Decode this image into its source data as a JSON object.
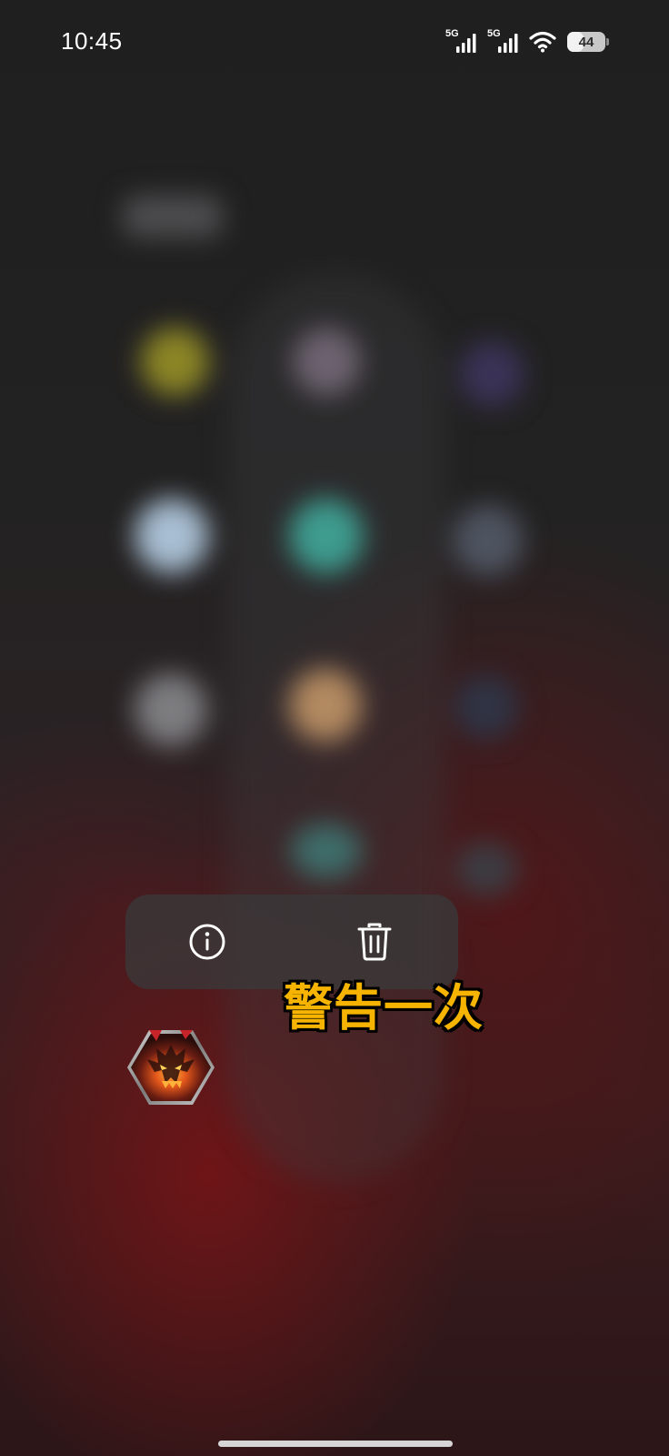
{
  "status_bar": {
    "time": "10:45",
    "network_1": "5G",
    "network_2": "5G",
    "battery_level": "44",
    "wifi_icon": "wifi-icon"
  },
  "context_menu": {
    "info_icon": "info-icon",
    "delete_icon": "trash-icon"
  },
  "overlay_caption": "警告一次",
  "app": {
    "icon": "game-app-icon"
  },
  "colors": {
    "caption_fill": "#f6b400",
    "caption_stroke": "#000000",
    "menu_background": "#3a383a"
  }
}
